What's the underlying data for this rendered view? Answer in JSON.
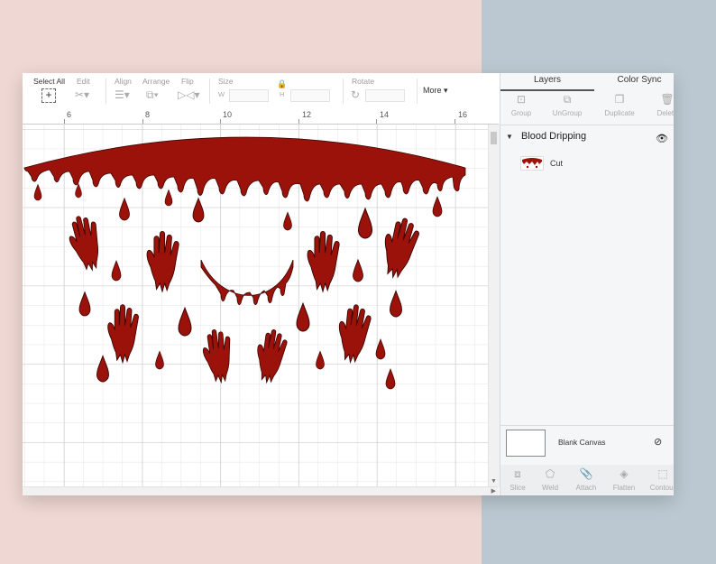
{
  "toolbar": {
    "select_all": "Select All",
    "edit": "Edit",
    "align": "Align",
    "arrange": "Arrange",
    "flip": "Flip",
    "size": "Size",
    "w": "W",
    "h": "H",
    "rotate": "Rotate",
    "more": "More ▾"
  },
  "ruler": {
    "ticks": [
      "6",
      "8",
      "10",
      "12",
      "14",
      "16"
    ]
  },
  "panel": {
    "tabs": [
      "Layers",
      "Color Sync"
    ],
    "tools": [
      "Group",
      "UnGroup",
      "Duplicate",
      "Delete"
    ],
    "layer_group": "Blood Dripping",
    "layer_item": "Cut",
    "blank_canvas": "Blank Canvas",
    "bottom_tools": [
      "Slice",
      "Weld",
      "Attach",
      "Flatten",
      "Contour"
    ]
  },
  "colors": {
    "blood": "#9a1209",
    "accent": "#555555"
  }
}
